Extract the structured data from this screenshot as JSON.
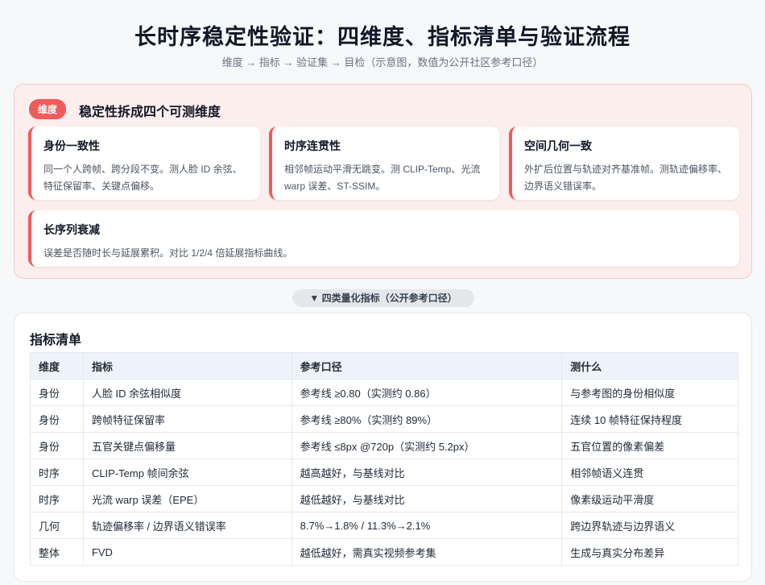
{
  "header": {
    "title": "长时序稳定性验证：四维度、指标清单与验证流程",
    "subtitle": "维度 → 指标 → 验证集 → 目检（示意图，数值为公开社区参考口径）"
  },
  "dimensions": {
    "badge": "维度",
    "heading": "稳定性拆成四个可测维度",
    "cards": [
      {
        "title": "身份一致性",
        "desc": "同一个人跨帧、跨分段不变。测人脸 ID 余弦、特征保留率、关键点偏移。"
      },
      {
        "title": "时序连贯性",
        "desc": "相邻帧运动平滑无跳变。测 CLIP-Temp、光流 warp 误差、ST-SSIM。"
      },
      {
        "title": "空间几何一致",
        "desc": "外扩后位置与轨迹对齐基准帧。测轨迹偏移率、边界语义错误率。"
      },
      {
        "title": "长序列衰减",
        "desc": "误差是否随时长与延展累积。对比 1/2/4 倍延展指标曲线。"
      }
    ]
  },
  "divider": {
    "label": "▼ 四类量化指标（公开参考口径）"
  },
  "metrics": {
    "title": "指标清单",
    "headers": [
      "维度",
      "指标",
      "参考口径",
      "测什么"
    ],
    "rows": [
      [
        "身份",
        "人脸 ID 余弦相似度",
        "参考线 ≥0.80（实测约 0.86）",
        "与参考图的身份相似度"
      ],
      [
        "身份",
        "跨帧特征保留率",
        "参考线 ≥80%（实测约 89%）",
        "连续 10 帧特征保持程度"
      ],
      [
        "身份",
        "五官关键点偏移量",
        "参考线 ≤8px @720p（实测约 5.2px）",
        "五官位置的像素偏差"
      ],
      [
        "时序",
        "CLIP-Temp 帧间余弦",
        "越高越好，与基线对比",
        "相邻帧语义连贯"
      ],
      [
        "时序",
        "光流 warp 误差（EPE）",
        "越低越好，与基线对比",
        "像素级运动平滑度"
      ],
      [
        "几何",
        "轨迹偏移率 / 边界语义错误率",
        "8.7%→1.8% / 11.3%→2.1%",
        "跨边界轨迹与边界语义"
      ],
      [
        "整体",
        "FVD",
        "越低越好，需真实视频参考集",
        "生成与真实分布差异"
      ]
    ]
  },
  "colors": {
    "accent": "#ef5b5b",
    "panel_bg": "#fdeeee",
    "table_header_bg": "#eef3fb"
  }
}
